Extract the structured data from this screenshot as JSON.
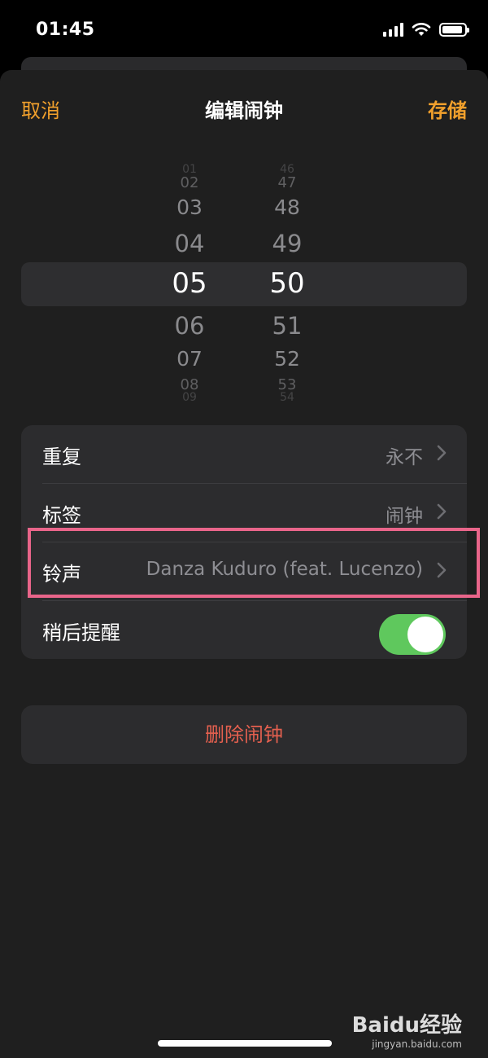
{
  "status_bar": {
    "time": "01:45"
  },
  "nav": {
    "cancel": "取消",
    "title": "编辑闹钟",
    "save": "存储"
  },
  "picker": {
    "hours": [
      "01",
      "02",
      "03",
      "04",
      "05",
      "06",
      "07",
      "08",
      "09"
    ],
    "minutes": [
      "46",
      "47",
      "48",
      "49",
      "50",
      "51",
      "52",
      "53",
      "54"
    ],
    "selected_hour": "05",
    "selected_minute": "50"
  },
  "settings": {
    "repeat": {
      "label": "重复",
      "value": "永不"
    },
    "tag": {
      "label": "标签",
      "value": "闹钟"
    },
    "ringtone": {
      "label": "铃声",
      "value": "Danza Kuduro (feat. Lucenzo)"
    },
    "snooze": {
      "label": "稍后提醒",
      "enabled": true
    }
  },
  "delete_label": "删除闹钟",
  "watermark": {
    "brand": "Baidu经验",
    "url": "jingyan.baidu.com"
  },
  "colors": {
    "accent": "#f1a02c",
    "destructive": "#e4604f",
    "toggle_on": "#5fc85d",
    "highlight": "#e9658a"
  }
}
